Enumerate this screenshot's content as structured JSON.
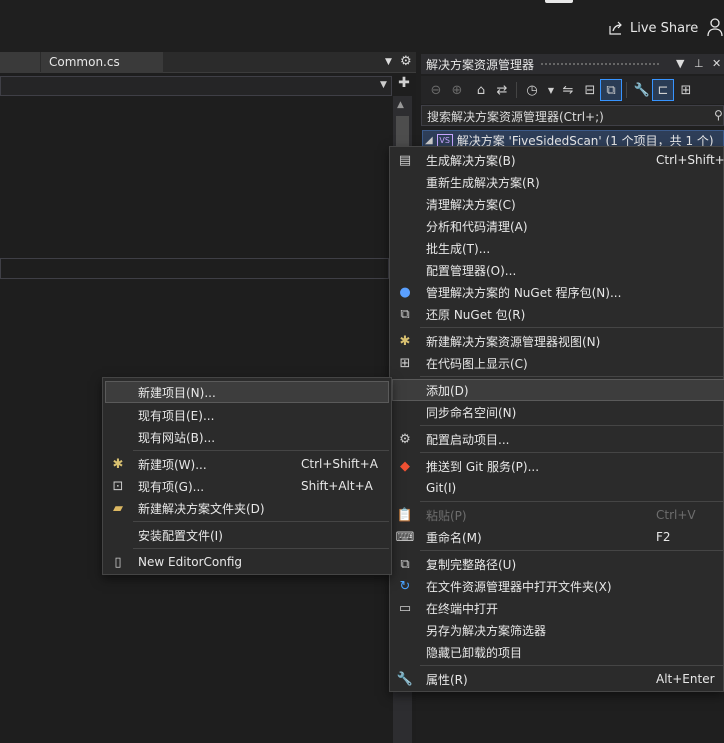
{
  "topbar": {
    "live_share_label": "Live Share"
  },
  "editor": {
    "tabs": [
      {
        "label": ""
      },
      {
        "label": "Common.cs"
      }
    ]
  },
  "solution_explorer": {
    "title": "解决方案资源管理器",
    "search_placeholder": "搜索解决方案资源管理器(Ctrl+;)",
    "root_label": "解决方案 'FiveSidedScan' (1 个项目，共 1 个)"
  },
  "context_menu": {
    "items": [
      {
        "label": "生成解决方案(B)",
        "shortcut": "Ctrl+Shift+B",
        "icon": "build-icon"
      },
      {
        "label": "重新生成解决方案(R)",
        "shortcut": ""
      },
      {
        "label": "清理解决方案(C)",
        "shortcut": ""
      },
      {
        "label": "分析和代码清理(A)",
        "shortcut": ""
      },
      {
        "label": "批生成(T)...",
        "shortcut": ""
      },
      {
        "label": "配置管理器(O)...",
        "shortcut": ""
      },
      {
        "label": "管理解决方案的 NuGet 程序包(N)...",
        "shortcut": "",
        "icon": "nuget-icon"
      },
      {
        "label": "还原 NuGet 包(R)",
        "shortcut": "",
        "icon": "restore-icon"
      },
      {
        "label": "新建解决方案资源管理器视图(N)",
        "shortcut": "",
        "icon": "new-view-icon"
      },
      {
        "label": "在代码图上显示(C)",
        "shortcut": "",
        "icon": "code-map-icon"
      },
      {
        "label": "添加(D)",
        "shortcut": ""
      },
      {
        "label": "同步命名空间(N)",
        "shortcut": ""
      },
      {
        "label": "配置启动项目...",
        "shortcut": "",
        "icon": "gear-icon"
      },
      {
        "label": "推送到 Git 服务(P)...",
        "shortcut": "",
        "icon": "git-push-icon"
      },
      {
        "label": "Git(I)",
        "shortcut": ""
      },
      {
        "label": "粘贴(P)",
        "shortcut": "Ctrl+V",
        "icon": "paste-icon",
        "disabled": true
      },
      {
        "label": "重命名(M)",
        "shortcut": "F2",
        "icon": "rename-icon"
      },
      {
        "label": "复制完整路径(U)",
        "shortcut": "",
        "icon": "copy-path-icon"
      },
      {
        "label": "在文件资源管理器中打开文件夹(X)",
        "shortcut": "",
        "icon": "open-folder-icon"
      },
      {
        "label": "在终端中打开",
        "shortcut": "",
        "icon": "terminal-icon"
      },
      {
        "label": "另存为解决方案筛选器",
        "shortcut": ""
      },
      {
        "label": "隐藏已卸载的项目",
        "shortcut": ""
      },
      {
        "label": "属性(R)",
        "shortcut": "Alt+Enter",
        "icon": "wrench-icon"
      }
    ]
  },
  "add_submenu": {
    "items": [
      {
        "label": "新建项目(N)...",
        "shortcut": ""
      },
      {
        "label": "现有项目(E)...",
        "shortcut": ""
      },
      {
        "label": "现有网站(B)...",
        "shortcut": ""
      },
      {
        "label": "新建项(W)...",
        "shortcut": "Ctrl+Shift+A",
        "icon": "new-item-icon"
      },
      {
        "label": "现有项(G)...",
        "shortcut": "Shift+Alt+A",
        "icon": "existing-item-icon"
      },
      {
        "label": "新建解决方案文件夹(D)",
        "shortcut": "",
        "icon": "new-folder-icon"
      },
      {
        "label": "安装配置文件(I)",
        "shortcut": ""
      },
      {
        "label": "New EditorConfig",
        "shortcut": "",
        "icon": "file-icon"
      }
    ]
  }
}
